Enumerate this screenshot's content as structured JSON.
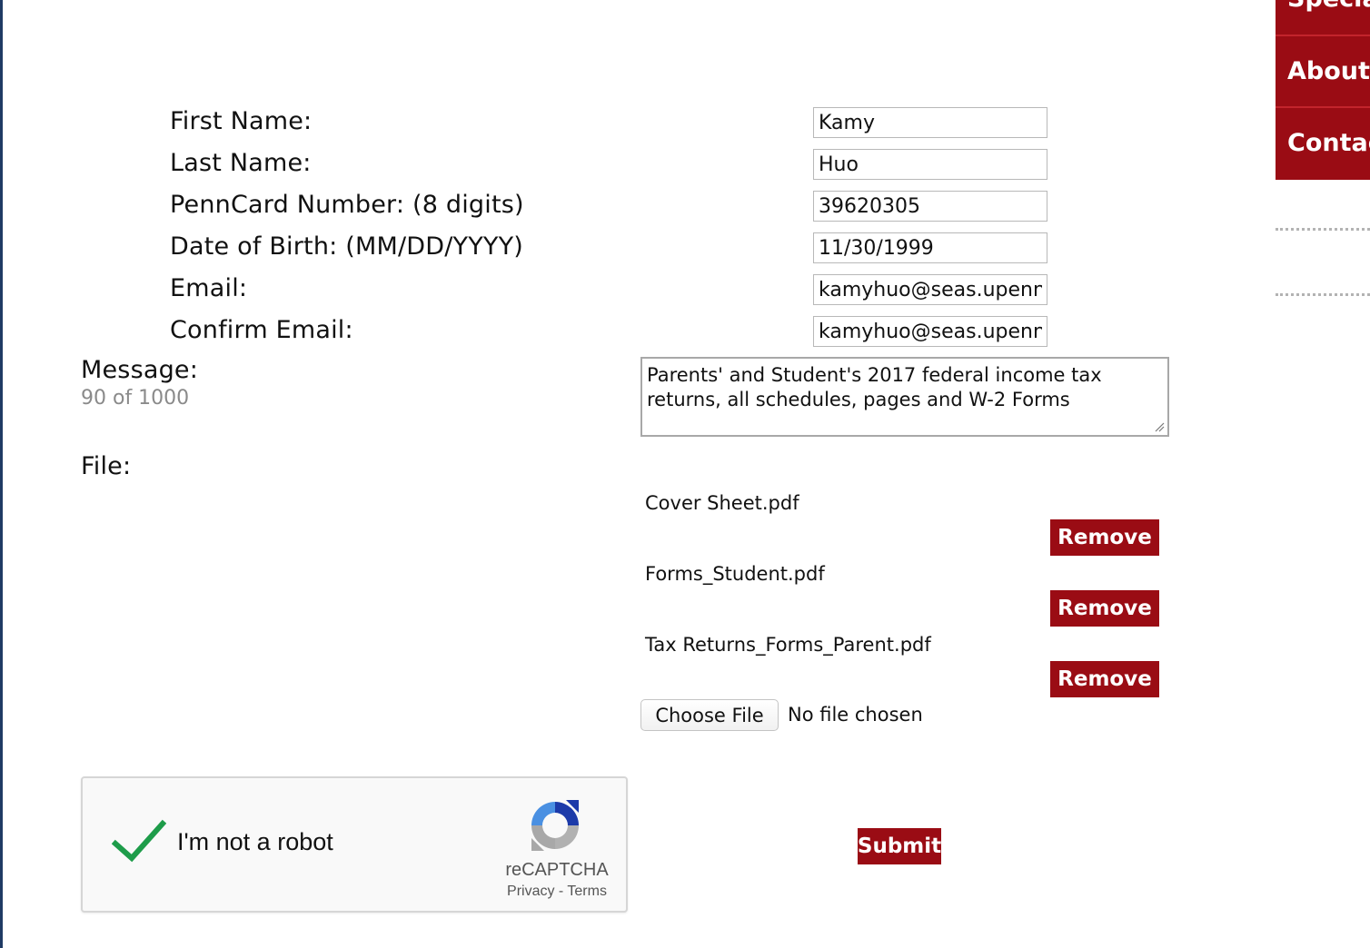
{
  "form": {
    "fields": [
      {
        "label": "First Name:",
        "value": "Kamy"
      },
      {
        "label": "Last Name:",
        "value": "Huo"
      },
      {
        "label": "PennCard Number: (8 digits)",
        "value": "39620305"
      },
      {
        "label": "Date of Birth: (MM/DD/YYYY)",
        "value": "11/30/1999"
      },
      {
        "label": "Email:",
        "value": "kamyhuo@seas.upenn.e"
      },
      {
        "label": "Confirm Email:",
        "value": "kamyhuo@seas.upenn.e"
      }
    ],
    "message": {
      "label": "Message:",
      "counter": "90 of 1000",
      "value": "Parents' and Student's 2017 federal income tax returns, all schedules, pages and W-2 Forms"
    },
    "file": {
      "label": "File:",
      "files": [
        {
          "name": "Cover Sheet.pdf",
          "remove_label": "Remove"
        },
        {
          "name": "Forms_Student.pdf",
          "remove_label": "Remove"
        },
        {
          "name": "Tax Returns_Forms_Parent.pdf",
          "remove_label": "Remove"
        }
      ],
      "choose_label": "Choose File",
      "no_file_text": "No file chosen"
    },
    "recaptcha": {
      "label": "I'm not a robot",
      "brand": "reCAPTCHA",
      "privacy": "Privacy",
      "separator": " - ",
      "terms": "Terms",
      "checked": true
    },
    "submit_label": "Submit"
  },
  "side_menu": {
    "items": [
      "Special",
      "About S",
      "Contact"
    ]
  },
  "colors": {
    "accent": "#9a0c14",
    "left_border": "#1f3a64",
    "check_green": "#1e9c4a"
  }
}
